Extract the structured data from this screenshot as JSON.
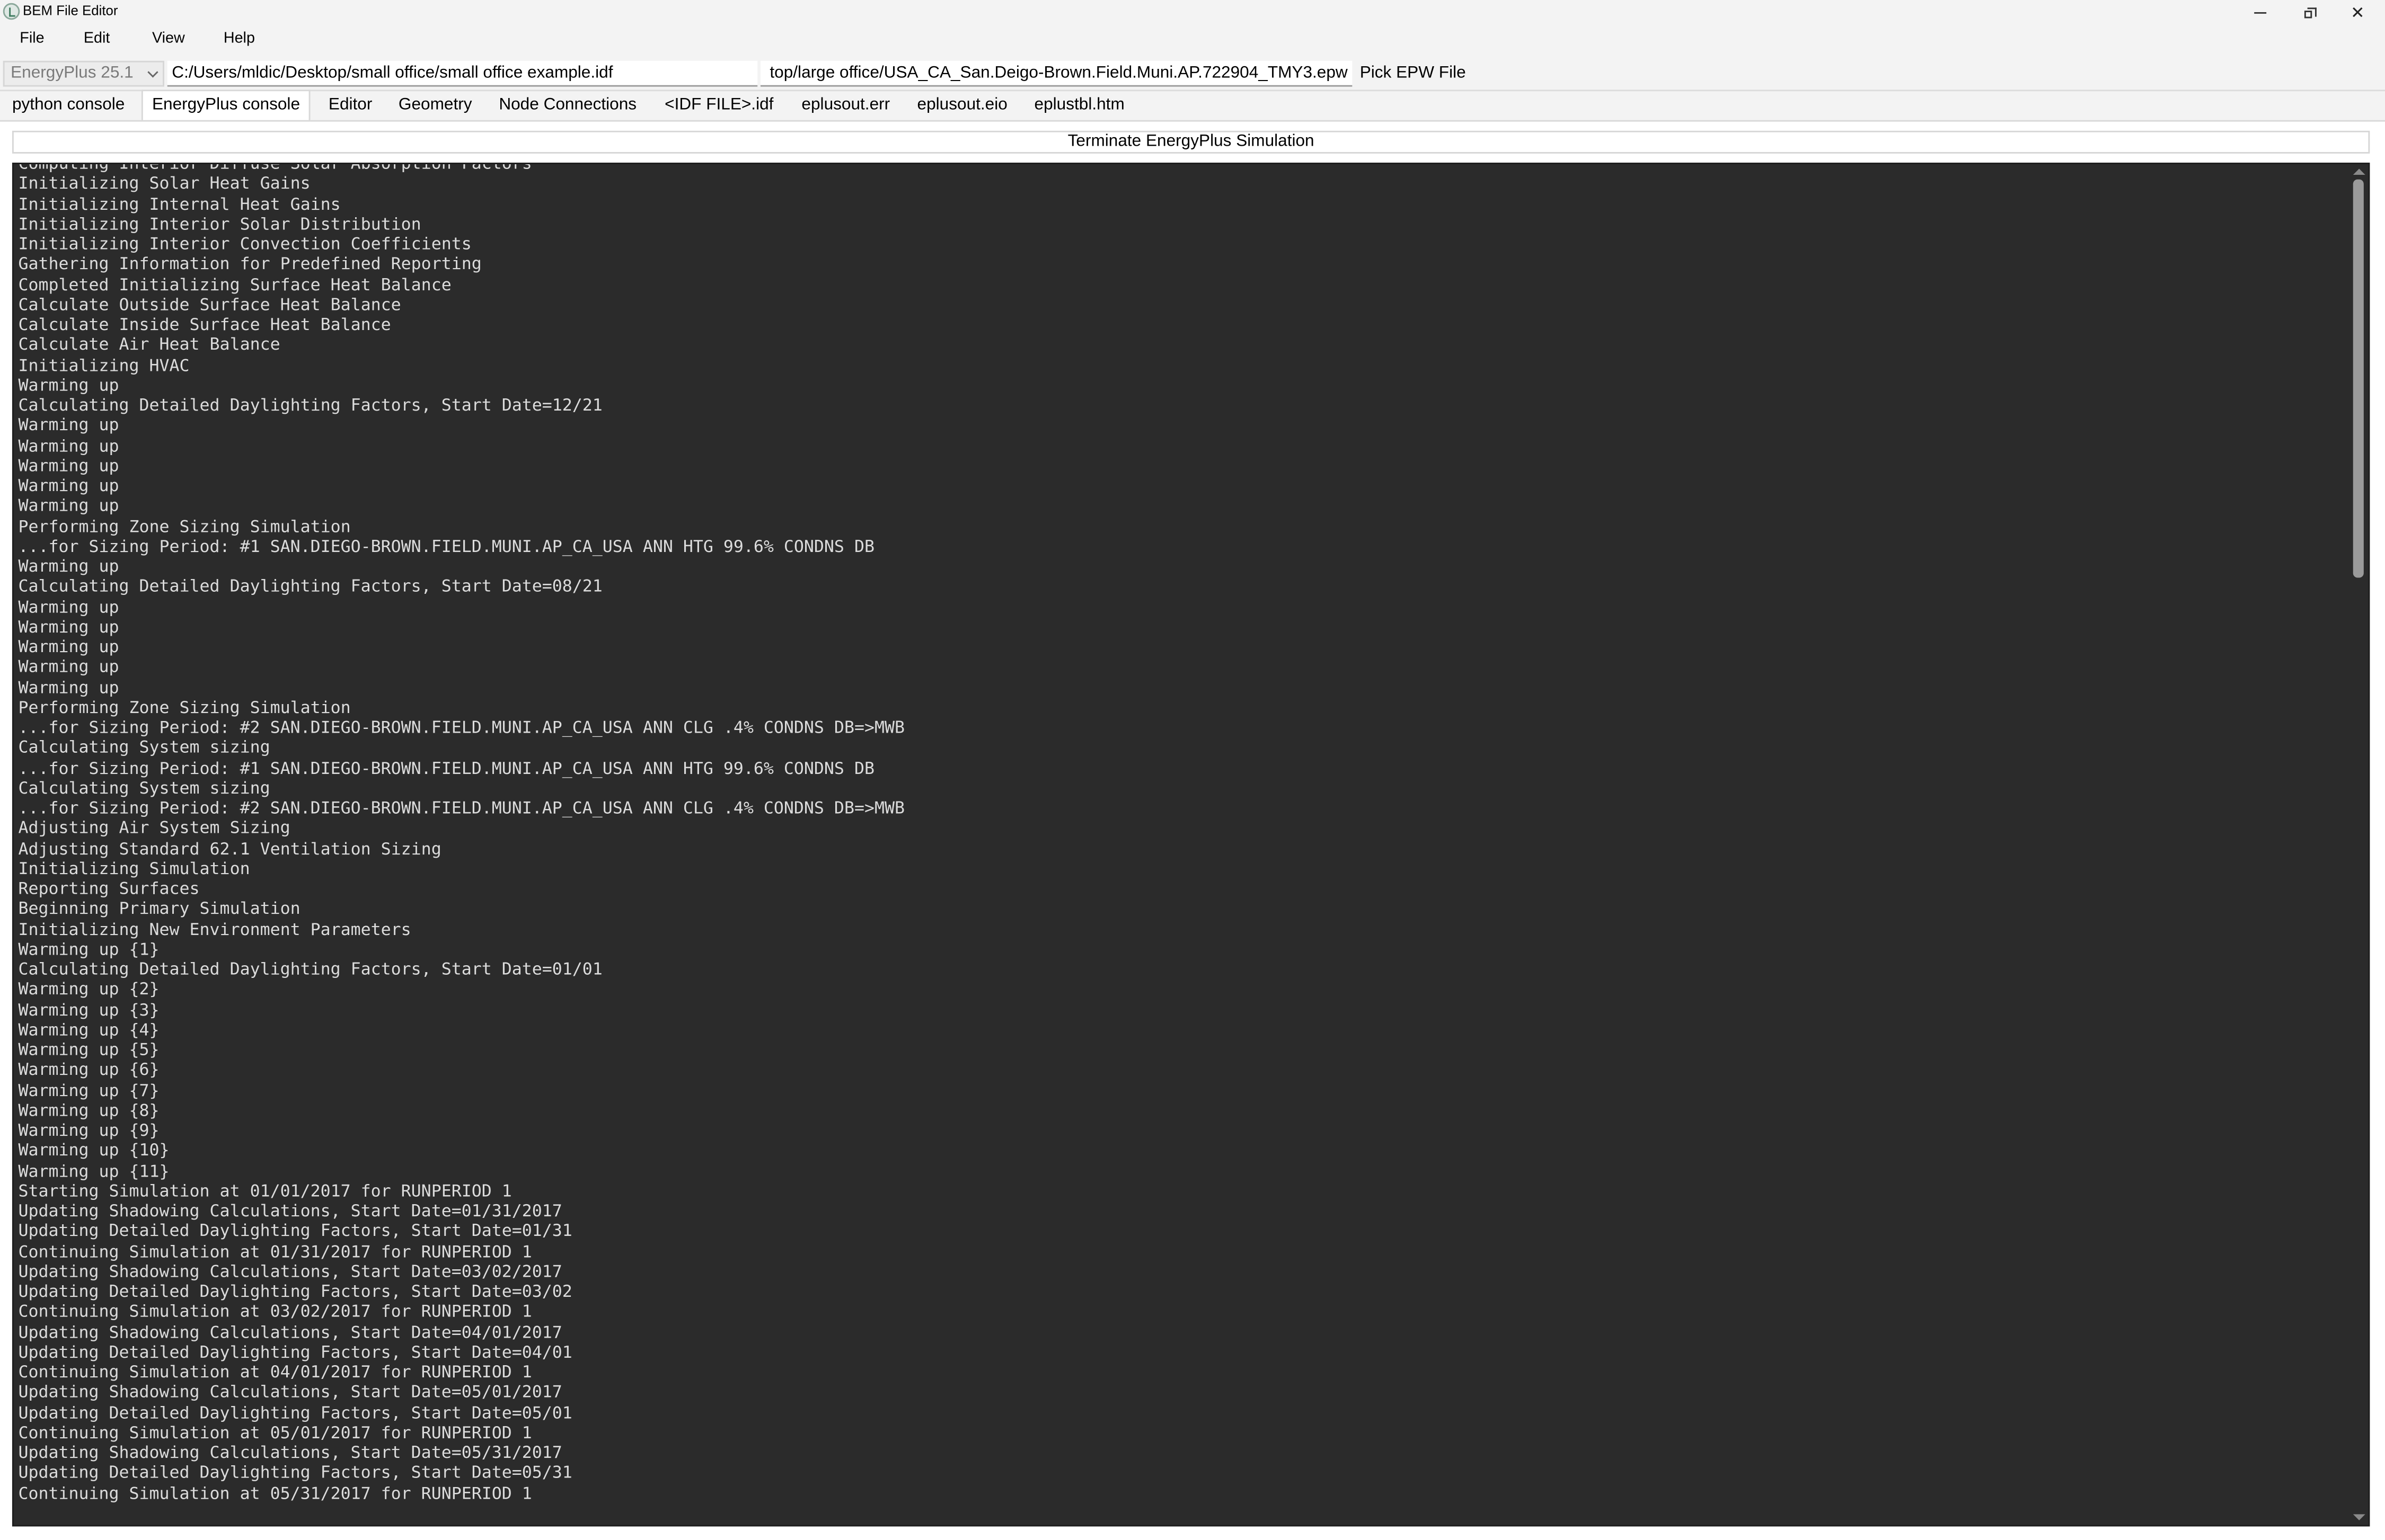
{
  "window": {
    "title": "BEM File Editor"
  },
  "menu": [
    "File",
    "Edit",
    "View",
    "Help"
  ],
  "pathbar": {
    "version": "EnergyPlus 25.1",
    "idf_path": "C:/Users/mldic/Desktop/small office/small office example.idf",
    "epw_path": "top/large office/USA_CA_San.Deigo-Brown.Field.Muni.AP.722904_TMY3.epw",
    "pick_label": "Pick EPW File"
  },
  "tabs": [
    {
      "label": "python console",
      "active": false
    },
    {
      "label": "EnergyPlus console",
      "active": true
    },
    {
      "label": "Editor",
      "active": false
    },
    {
      "label": "Geometry",
      "active": false
    },
    {
      "label": "Node Connections",
      "active": false
    },
    {
      "label": "<IDF FILE>.idf",
      "active": false
    },
    {
      "label": "eplusout.err",
      "active": false
    },
    {
      "label": "eplusout.eio",
      "active": false
    },
    {
      "label": "eplustbl.htm",
      "active": false
    }
  ],
  "terminate_label": "Terminate EnergyPlus Simulation",
  "console_lines": [
    "Computing Interior Diffuse Solar Absorption Factors",
    "Initializing Solar Heat Gains",
    "Initializing Internal Heat Gains",
    "Initializing Interior Solar Distribution",
    "Initializing Interior Convection Coefficients",
    "Gathering Information for Predefined Reporting",
    "Completed Initializing Surface Heat Balance",
    "Calculate Outside Surface Heat Balance",
    "Calculate Inside Surface Heat Balance",
    "Calculate Air Heat Balance",
    "Initializing HVAC",
    "Warming up",
    "Calculating Detailed Daylighting Factors, Start Date=12/21",
    "Warming up",
    "Warming up",
    "Warming up",
    "Warming up",
    "Warming up",
    "Performing Zone Sizing Simulation",
    "...for Sizing Period: #1 SAN.DIEGO-BROWN.FIELD.MUNI.AP_CA_USA ANN HTG 99.6% CONDNS DB",
    "Warming up",
    "Calculating Detailed Daylighting Factors, Start Date=08/21",
    "Warming up",
    "Warming up",
    "Warming up",
    "Warming up",
    "Warming up",
    "Performing Zone Sizing Simulation",
    "...for Sizing Period: #2 SAN.DIEGO-BROWN.FIELD.MUNI.AP_CA_USA ANN CLG .4% CONDNS DB=>MWB",
    "Calculating System sizing",
    "...for Sizing Period: #1 SAN.DIEGO-BROWN.FIELD.MUNI.AP_CA_USA ANN HTG 99.6% CONDNS DB",
    "Calculating System sizing",
    "...for Sizing Period: #2 SAN.DIEGO-BROWN.FIELD.MUNI.AP_CA_USA ANN CLG .4% CONDNS DB=>MWB",
    "Adjusting Air System Sizing",
    "Adjusting Standard 62.1 Ventilation Sizing",
    "Initializing Simulation",
    "Reporting Surfaces",
    "Beginning Primary Simulation",
    "Initializing New Environment Parameters",
    "Warming up {1}",
    "Calculating Detailed Daylighting Factors, Start Date=01/01",
    "Warming up {2}",
    "Warming up {3}",
    "Warming up {4}",
    "Warming up {5}",
    "Warming up {6}",
    "Warming up {7}",
    "Warming up {8}",
    "Warming up {9}",
    "Warming up {10}",
    "Warming up {11}",
    "Starting Simulation at 01/01/2017 for RUNPERIOD 1",
    "Updating Shadowing Calculations, Start Date=01/31/2017",
    "Updating Detailed Daylighting Factors, Start Date=01/31",
    "Continuing Simulation at 01/31/2017 for RUNPERIOD 1",
    "Updating Shadowing Calculations, Start Date=03/02/2017",
    "Updating Detailed Daylighting Factors, Start Date=03/02",
    "Continuing Simulation at 03/02/2017 for RUNPERIOD 1",
    "Updating Shadowing Calculations, Start Date=04/01/2017",
    "Updating Detailed Daylighting Factors, Start Date=04/01",
    "Continuing Simulation at 04/01/2017 for RUNPERIOD 1",
    "Updating Shadowing Calculations, Start Date=05/01/2017",
    "Updating Detailed Daylighting Factors, Start Date=05/01",
    "Continuing Simulation at 05/01/2017 for RUNPERIOD 1",
    "Updating Shadowing Calculations, Start Date=05/31/2017",
    "Updating Detailed Daylighting Factors, Start Date=05/31",
    "Continuing Simulation at 05/31/2017 for RUNPERIOD 1"
  ],
  "colors": {
    "console_bg": "#2b2b2b",
    "console_text": "#dcdcdc",
    "chrome_bg": "#f3f3f3"
  }
}
